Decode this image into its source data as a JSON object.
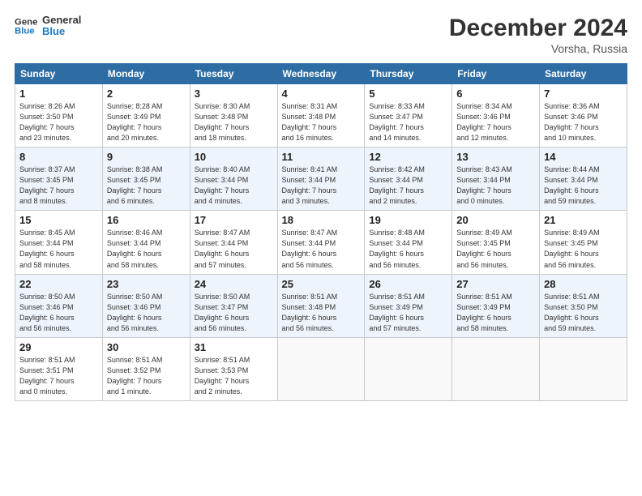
{
  "header": {
    "logo_line1": "General",
    "logo_line2": "Blue",
    "main_title": "December 2024",
    "subtitle": "Vorsha, Russia"
  },
  "days_of_week": [
    "Sunday",
    "Monday",
    "Tuesday",
    "Wednesday",
    "Thursday",
    "Friday",
    "Saturday"
  ],
  "weeks": [
    [
      {
        "day": "1",
        "info": "Sunrise: 8:26 AM\nSunset: 3:50 PM\nDaylight: 7 hours\nand 23 minutes."
      },
      {
        "day": "2",
        "info": "Sunrise: 8:28 AM\nSunset: 3:49 PM\nDaylight: 7 hours\nand 20 minutes."
      },
      {
        "day": "3",
        "info": "Sunrise: 8:30 AM\nSunset: 3:48 PM\nDaylight: 7 hours\nand 18 minutes."
      },
      {
        "day": "4",
        "info": "Sunrise: 8:31 AM\nSunset: 3:48 PM\nDaylight: 7 hours\nand 16 minutes."
      },
      {
        "day": "5",
        "info": "Sunrise: 8:33 AM\nSunset: 3:47 PM\nDaylight: 7 hours\nand 14 minutes."
      },
      {
        "day": "6",
        "info": "Sunrise: 8:34 AM\nSunset: 3:46 PM\nDaylight: 7 hours\nand 12 minutes."
      },
      {
        "day": "7",
        "info": "Sunrise: 8:36 AM\nSunset: 3:46 PM\nDaylight: 7 hours\nand 10 minutes."
      }
    ],
    [
      {
        "day": "8",
        "info": "Sunrise: 8:37 AM\nSunset: 3:45 PM\nDaylight: 7 hours\nand 8 minutes."
      },
      {
        "day": "9",
        "info": "Sunrise: 8:38 AM\nSunset: 3:45 PM\nDaylight: 7 hours\nand 6 minutes."
      },
      {
        "day": "10",
        "info": "Sunrise: 8:40 AM\nSunset: 3:44 PM\nDaylight: 7 hours\nand 4 minutes."
      },
      {
        "day": "11",
        "info": "Sunrise: 8:41 AM\nSunset: 3:44 PM\nDaylight: 7 hours\nand 3 minutes."
      },
      {
        "day": "12",
        "info": "Sunrise: 8:42 AM\nSunset: 3:44 PM\nDaylight: 7 hours\nand 2 minutes."
      },
      {
        "day": "13",
        "info": "Sunrise: 8:43 AM\nSunset: 3:44 PM\nDaylight: 7 hours\nand 0 minutes."
      },
      {
        "day": "14",
        "info": "Sunrise: 8:44 AM\nSunset: 3:44 PM\nDaylight: 6 hours\nand 59 minutes."
      }
    ],
    [
      {
        "day": "15",
        "info": "Sunrise: 8:45 AM\nSunset: 3:44 PM\nDaylight: 6 hours\nand 58 minutes."
      },
      {
        "day": "16",
        "info": "Sunrise: 8:46 AM\nSunset: 3:44 PM\nDaylight: 6 hours\nand 58 minutes."
      },
      {
        "day": "17",
        "info": "Sunrise: 8:47 AM\nSunset: 3:44 PM\nDaylight: 6 hours\nand 57 minutes."
      },
      {
        "day": "18",
        "info": "Sunrise: 8:47 AM\nSunset: 3:44 PM\nDaylight: 6 hours\nand 56 minutes."
      },
      {
        "day": "19",
        "info": "Sunrise: 8:48 AM\nSunset: 3:44 PM\nDaylight: 6 hours\nand 56 minutes."
      },
      {
        "day": "20",
        "info": "Sunrise: 8:49 AM\nSunset: 3:45 PM\nDaylight: 6 hours\nand 56 minutes."
      },
      {
        "day": "21",
        "info": "Sunrise: 8:49 AM\nSunset: 3:45 PM\nDaylight: 6 hours\nand 56 minutes."
      }
    ],
    [
      {
        "day": "22",
        "info": "Sunrise: 8:50 AM\nSunset: 3:46 PM\nDaylight: 6 hours\nand 56 minutes."
      },
      {
        "day": "23",
        "info": "Sunrise: 8:50 AM\nSunset: 3:46 PM\nDaylight: 6 hours\nand 56 minutes."
      },
      {
        "day": "24",
        "info": "Sunrise: 8:50 AM\nSunset: 3:47 PM\nDaylight: 6 hours\nand 56 minutes."
      },
      {
        "day": "25",
        "info": "Sunrise: 8:51 AM\nSunset: 3:48 PM\nDaylight: 6 hours\nand 56 minutes."
      },
      {
        "day": "26",
        "info": "Sunrise: 8:51 AM\nSunset: 3:49 PM\nDaylight: 6 hours\nand 57 minutes."
      },
      {
        "day": "27",
        "info": "Sunrise: 8:51 AM\nSunset: 3:49 PM\nDaylight: 6 hours\nand 58 minutes."
      },
      {
        "day": "28",
        "info": "Sunrise: 8:51 AM\nSunset: 3:50 PM\nDaylight: 6 hours\nand 59 minutes."
      }
    ],
    [
      {
        "day": "29",
        "info": "Sunrise: 8:51 AM\nSunset: 3:51 PM\nDaylight: 7 hours\nand 0 minutes."
      },
      {
        "day": "30",
        "info": "Sunrise: 8:51 AM\nSunset: 3:52 PM\nDaylight: 7 hours\nand 1 minute."
      },
      {
        "day": "31",
        "info": "Sunrise: 8:51 AM\nSunset: 3:53 PM\nDaylight: 7 hours\nand 2 minutes."
      },
      {
        "day": "",
        "info": ""
      },
      {
        "day": "",
        "info": ""
      },
      {
        "day": "",
        "info": ""
      },
      {
        "day": "",
        "info": ""
      }
    ]
  ]
}
